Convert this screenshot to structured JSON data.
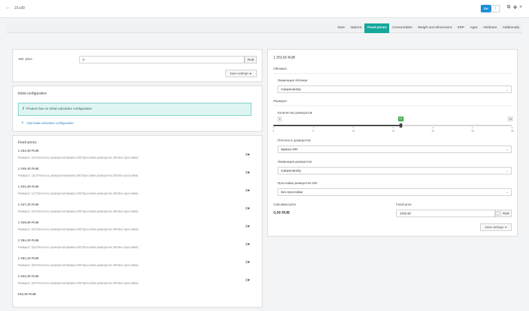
{
  "topbar": {
    "back_icon": "arrow-left-icon",
    "title": "21x30",
    "toggle_on": "On",
    "toggle_off": "|",
    "copy_icon": "⧉",
    "move_icon": "✥",
    "close_icon": "×"
  },
  "tabs": [
    "Main",
    "Options",
    "Fixed prices",
    "Consumables",
    "Weight and dimensions",
    "ERP",
    "Apps",
    "Attributes",
    "Additionally"
  ],
  "active_tab": "Fixed prices",
  "min_price": {
    "label": "Min. price",
    "value": "0",
    "unit": "RUB",
    "save_label": "Save settings"
  },
  "initial_config": {
    "title": "Initial configuration",
    "notice": "Product has no initial calculator configuration.",
    "add_link": "Add initial calculator configuration"
  },
  "fixed_prices": {
    "title": "Fixed prices",
    "items": [
      {
        "price": "1 252,60 RUB",
        "desc": "Разворот: (16;Плотность разворотов:Бумага 200;Прослойка разворотов 200:Без прослойки)"
      },
      {
        "price": "1 049,40 RUB",
        "desc": "Разворот: (11;Плотность разворотов:Бумага 200;Прослойка разворотов 200:Без прослойки)"
      },
      {
        "price": "1 201,80 RUB",
        "desc": "Разворот: (17;Плотность разворотов:Бумага 200;Прослойка разворотов 200:Без прослойки)"
      },
      {
        "price": "1 227,20 RUB",
        "desc": "Разворот: (18;Плотность разворотов:Бумага 200;Прослойка разворотов 200:Без прослойки)"
      },
      {
        "price": "1 328,80 RUB",
        "desc": "Разворот: (22;Плотность разворотов:Бумага 200;Прослойка разворотов 200:Без прослойки)"
      },
      {
        "price": "1 354,20 RUB",
        "desc": "Разворот: (23;Плотность разворотов:Бумага 200;Прослойка разворотов 200:Без прослойки)"
      },
      {
        "price": "1 481,20 RUB",
        "desc": "Разворот: (28;Плотность разворотов:Бумага 200;Прослойка разворотов 200:Без прослойки)"
      },
      {
        "price": "1 532,00 RUB",
        "desc": "Разворот: (30;Плотность разворотов:Бумага 200;Прослойка разворотов 200:Без прослойки)"
      },
      {
        "price": "542,00 RUB",
        "desc": ""
      }
    ]
  },
  "editor": {
    "total": "1 252,60 RUB",
    "cover_section": "Обложка",
    "cover_lam_label": "Ламинация обложки",
    "cover_lam_value": "Independently",
    "spread_section": "Разворот",
    "spread_count_label": "Количество разворотов",
    "slider": {
      "min": "0",
      "max": "30",
      "value": "16",
      "fraction": 0.5333
    },
    "ticks": [
      "0",
      "5",
      "10",
      "15",
      "20",
      "25",
      "30"
    ],
    "density_label": "Плотность разворотов",
    "density_value": "Бумага 200",
    "spread_lam_label": "Ламинация разворотов",
    "spread_lam_value": "Independently",
    "interlayer_label": "Прослойка разворотов 200",
    "interlayer_value": "Без прослойки",
    "calc_price_label": "Calculated price",
    "calc_price_value": "0,00 RUB",
    "fixed_price_label": "Fixed price",
    "fixed_price_value": "1252,60",
    "fixed_price_unit": "RUB",
    "save_label": "Save settings"
  }
}
